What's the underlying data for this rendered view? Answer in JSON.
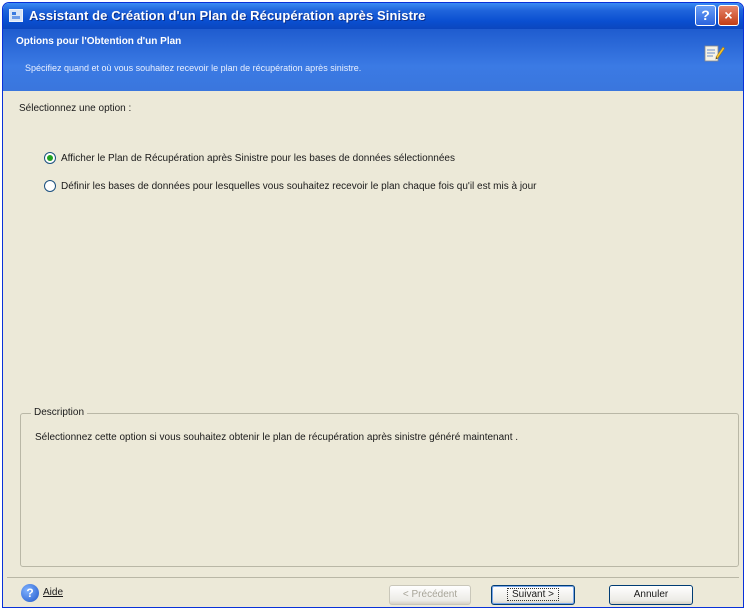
{
  "window": {
    "title": "Assistant de Création d'un Plan de Récupération après Sinistre",
    "help_button": "?",
    "close_button": "×"
  },
  "header": {
    "title": "Options pour l'Obtention d'un Plan",
    "subtitle": "Spécifiez quand et où vous souhaitez recevoir le plan de récupération après sinistre."
  },
  "main": {
    "prompt": "Sélectionnez une option :",
    "options": [
      {
        "label": "Afficher le Plan de Récupération après Sinistre pour les bases de données sélectionnées",
        "checked": true
      },
      {
        "label": "Définir les bases de données pour lesquelles vous souhaitez recevoir le plan chaque fois qu'il est mis à jour",
        "checked": false
      }
    ]
  },
  "description": {
    "legend": "Description",
    "text": "Sélectionnez cette option si vous souhaitez obtenir le plan de récupération après sinistre généré maintenant ."
  },
  "footer": {
    "help_label": "Aide",
    "prev_label": "< Précédent",
    "next_label": "Suivant >",
    "cancel_label": "Annuler"
  },
  "colors": {
    "title_bar": "#0A4FD0",
    "header_band": "#3B7AE4",
    "dialog_bg": "#ECE9D8",
    "radio_dot": "#21A121"
  },
  "icons": [
    "app-icon",
    "help-icon",
    "close-icon",
    "wizard-icon",
    "help-circle-icon"
  ]
}
